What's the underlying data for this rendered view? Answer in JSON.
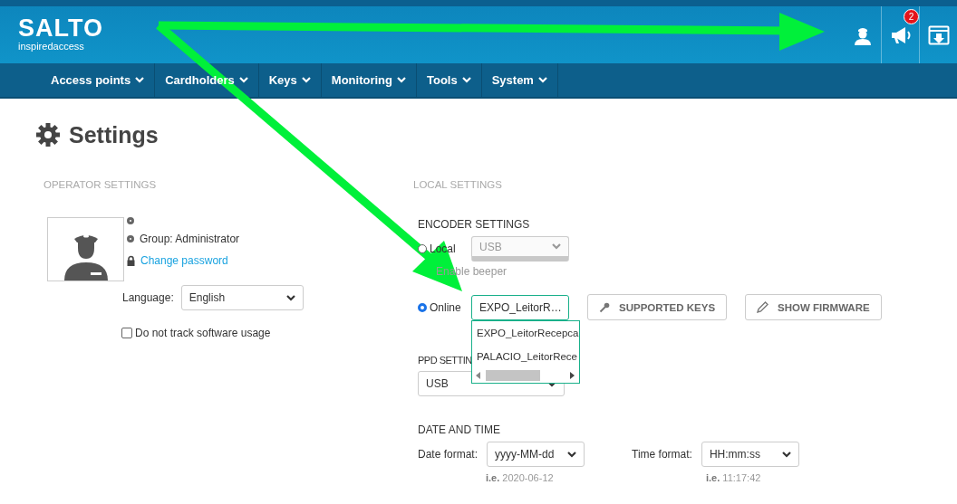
{
  "header": {
    "logo": "SALTO",
    "tagline": "inspiredaccess",
    "notifications_badge": "2"
  },
  "nav": [
    {
      "label": "Access points"
    },
    {
      "label": "Cardholders"
    },
    {
      "label": "Keys"
    },
    {
      "label": "Monitoring"
    },
    {
      "label": "Tools"
    },
    {
      "label": "System"
    }
  ],
  "page_title": "Settings",
  "operator_settings": {
    "heading": "OPERATOR SETTINGS",
    "group": "Group: Administrator",
    "change_password": "Change password",
    "language_label": "Language:",
    "language": "English",
    "no_tracking": {
      "label": "Do not track software usage",
      "checked": false
    }
  },
  "local_settings": {
    "heading": "LOCAL SETTINGS",
    "encoder": {
      "heading": "ENCODER SETTINGS",
      "modes": [
        {
          "label": "Local",
          "selected": false,
          "value": "USB",
          "disabled": true
        },
        {
          "label": "Online",
          "selected": true,
          "value": "EXPO_LeitorR…",
          "disabled": false
        }
      ],
      "beeper": {
        "label": "Enable beeper",
        "disabled": true
      },
      "dropdown_options": [
        "EXPO_LeitorRecepca",
        "PALACIO_LeitorRece"
      ],
      "buttons": [
        {
          "kind": "key",
          "label": "SUPPORTED KEYS"
        },
        {
          "kind": "pencil",
          "label": "SHOW FIRMWARE"
        }
      ]
    },
    "ppd": {
      "heading": "PPD SETTIN",
      "value": "USB"
    },
    "date_time": {
      "heading": "DATE AND TIME",
      "date_label": "Date format:",
      "date_value": "yyyy-MM-dd",
      "date_example_prefix": "i.e.",
      "date_example": "2020-06-12",
      "time_label": "Time format:",
      "time_value": "HH:mm:ss",
      "time_example_prefix": "i.e.",
      "time_example": "11:17:42"
    }
  }
}
